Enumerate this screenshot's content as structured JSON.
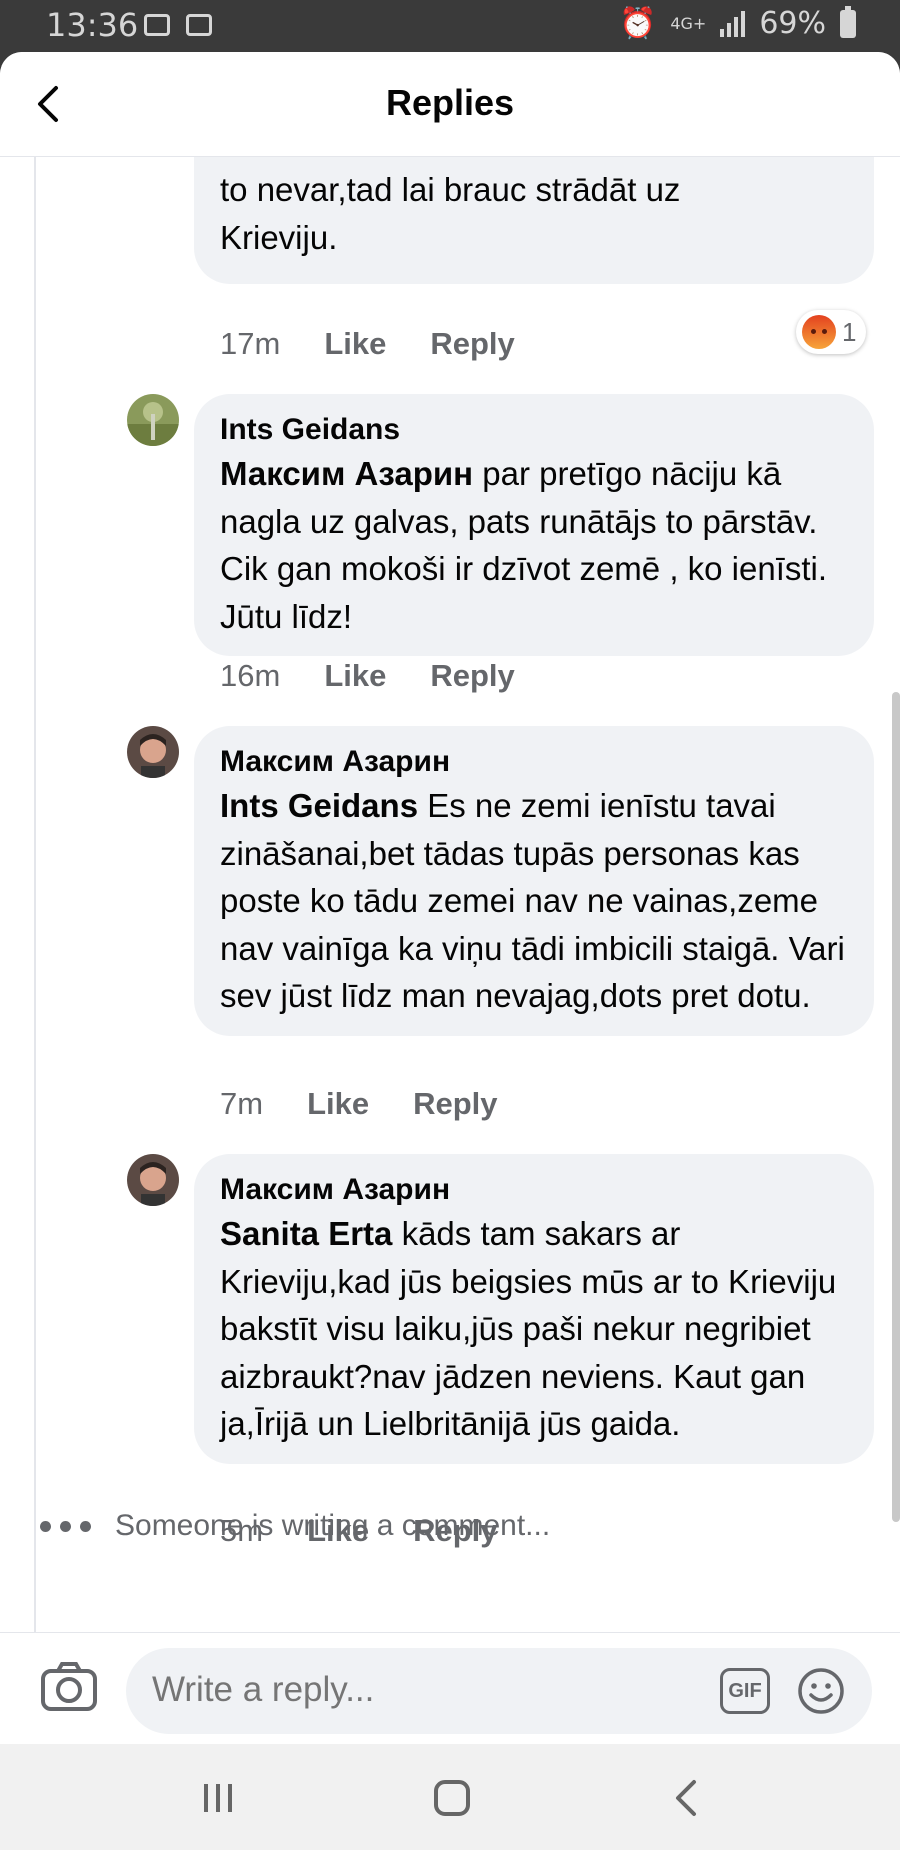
{
  "status_bar": {
    "time": "13:36",
    "network": "4G+",
    "battery": "69%"
  },
  "header": {
    "title": "Replies"
  },
  "comments": [
    {
      "text_line1": "to nevar,tad lai brauc strādāt uz",
      "text_line2": "Krieviju.",
      "time": "17m",
      "like": "Like",
      "reply": "Reply",
      "reaction_count": "1"
    },
    {
      "author": "Ints Geidans",
      "mention": "Максим Азарин",
      "text": " par pretīgo nāciju kā nagla uz galvas, pats runātājs to pārstāv. Cik gan mokoši ir dzīvot zemē , ko ienīsti. Jūtu līdz!",
      "time": "16m",
      "like": "Like",
      "reply": "Reply"
    },
    {
      "author": "Максим Азарин",
      "mention": "Ints Geidans",
      "text": " Es ne zemi ienīstu tavai zināšanai,bet tādas tupās personas kas poste ko tādu zemei nav ne vainas,zeme nav vainīga ka viņu tādi imbicili staigā. Vari sev jūst līdz man nevajag,dots pret dotu.",
      "time": "7m",
      "like": "Like",
      "reply": "Reply"
    },
    {
      "author": "Максим Азарин",
      "mention": "Sanita Erta",
      "text": " kāds tam sakars ar Krieviju,kad jūs beigsies mūs ar to Krieviju bakstīt visu laiku,jūs paši nekur negribiet aizbraukt?nav jādzen neviens. Kaut gan ja,Īrijā un Lielbritānijā jūs gaida.",
      "time": "5m",
      "like": "Like",
      "reply": "Reply"
    }
  ],
  "typing_indicator": "Someone is writing a comment...",
  "composer": {
    "placeholder": "Write a reply...",
    "gif_label": "GIF"
  }
}
